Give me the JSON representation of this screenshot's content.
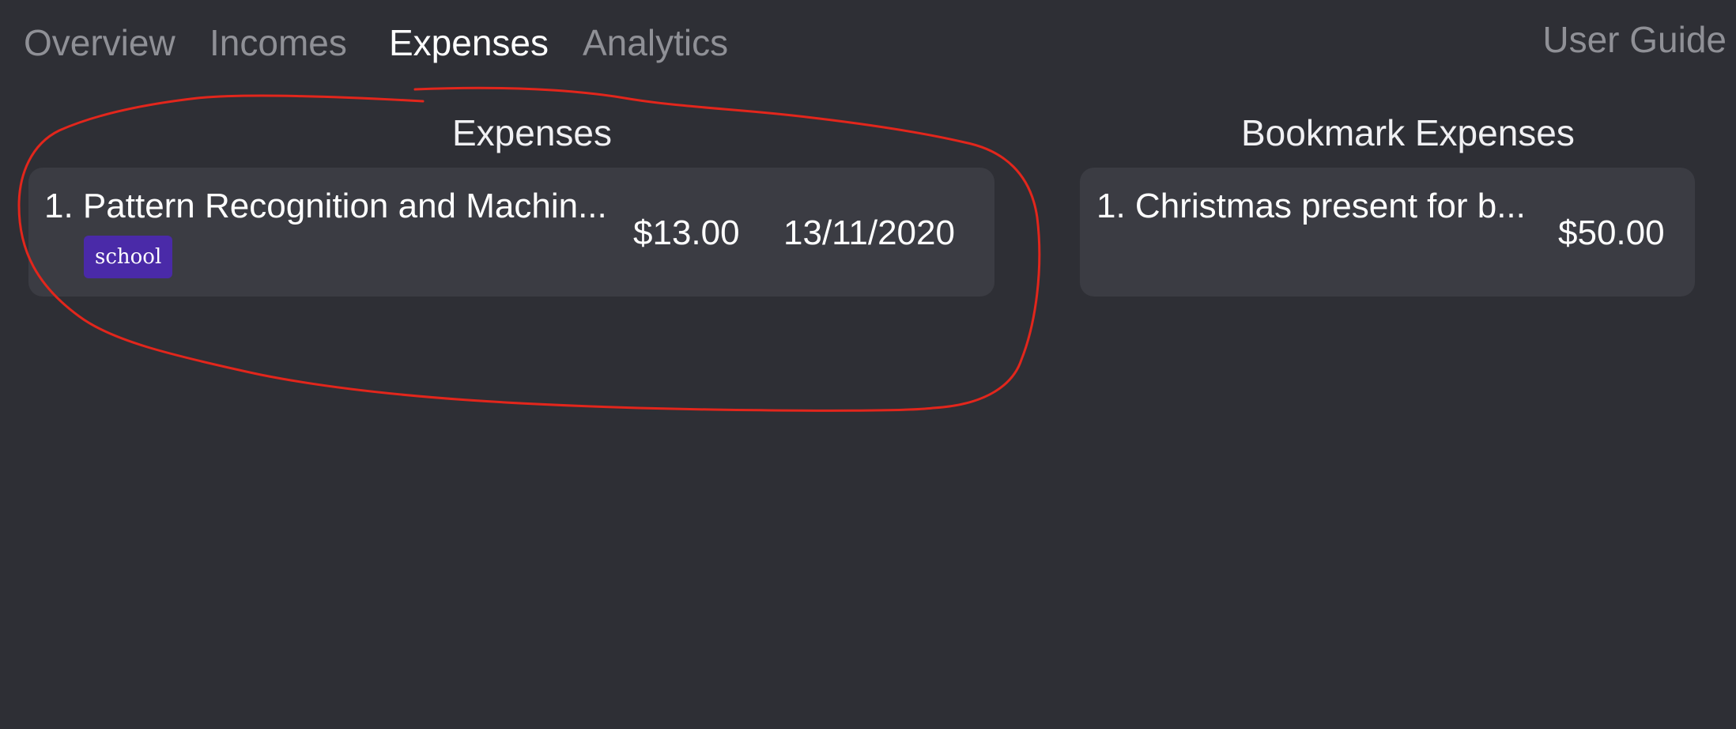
{
  "tabs": [
    {
      "label": "Overview",
      "active": false
    },
    {
      "label": "Incomes",
      "active": false
    },
    {
      "label": "Expenses",
      "active": true
    },
    {
      "label": "Analytics",
      "active": false
    }
  ],
  "user_guide_label": "User Guide",
  "expenses_panel": {
    "title": "Expenses",
    "items": [
      {
        "index_title": "1. Pattern Recognition and Machin...",
        "tag": "school",
        "amount": "$13.00",
        "date": "13/11/2020"
      }
    ]
  },
  "bookmark_panel": {
    "title": "Bookmark Expenses",
    "items": [
      {
        "index_title": "1. Christmas present for b...",
        "amount": "$50.00"
      }
    ]
  },
  "colors": {
    "background": "#2e2f35",
    "card": "#3b3c43",
    "active_tab": "#ffffff",
    "inactive_tab": "#8f9096",
    "tag": "#4a2aa8",
    "annotation": "#e2261c"
  }
}
